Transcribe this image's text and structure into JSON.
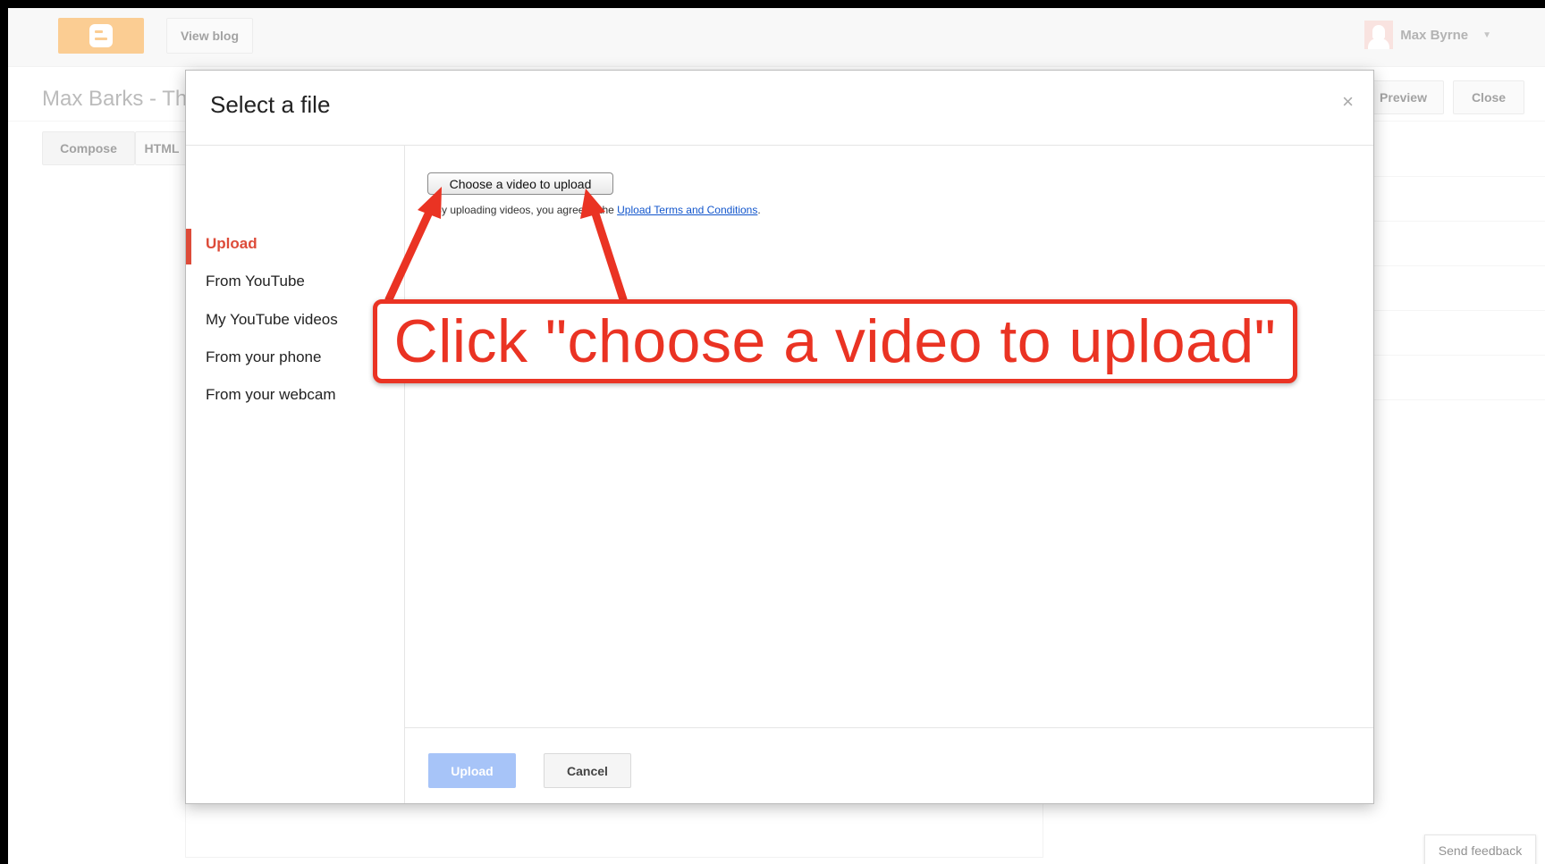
{
  "topbar": {
    "logo_icon": "blogger-logo-icon",
    "view_blog_label": "View blog",
    "user_name": "Max Byrne",
    "user_menu_icon": "chevron-down-icon"
  },
  "subheader": {
    "blog_title": "Max Barks - Th",
    "preview_label": "Preview",
    "close_label": "Close"
  },
  "editor_tabs": {
    "compose_label": "Compose",
    "html_label": "HTML"
  },
  "dialog": {
    "title": "Select a file",
    "close_glyph": "×",
    "nav": [
      {
        "label": "Upload",
        "active": true
      },
      {
        "label": "From YouTube"
      },
      {
        "label": "My YouTube videos"
      },
      {
        "label": "From your phone"
      },
      {
        "label": "From your webcam"
      }
    ],
    "choose_button_label": "Choose a video to upload",
    "terms_prefix": "By uploading videos, you agree to the ",
    "terms_link": "Upload Terms and Conditions",
    "terms_suffix": ".",
    "upload_button_label": "Upload",
    "cancel_button_label": "Cancel"
  },
  "annotation": {
    "text": "Click \"choose a video to upload\"",
    "color": "#ea3323"
  },
  "feedback_label": "Send feedback",
  "colors": {
    "blogger_orange": "#f79a27",
    "active_red": "#dd4b39",
    "link_blue": "#1155cc",
    "disabled_blue": "#a7c4f8"
  }
}
